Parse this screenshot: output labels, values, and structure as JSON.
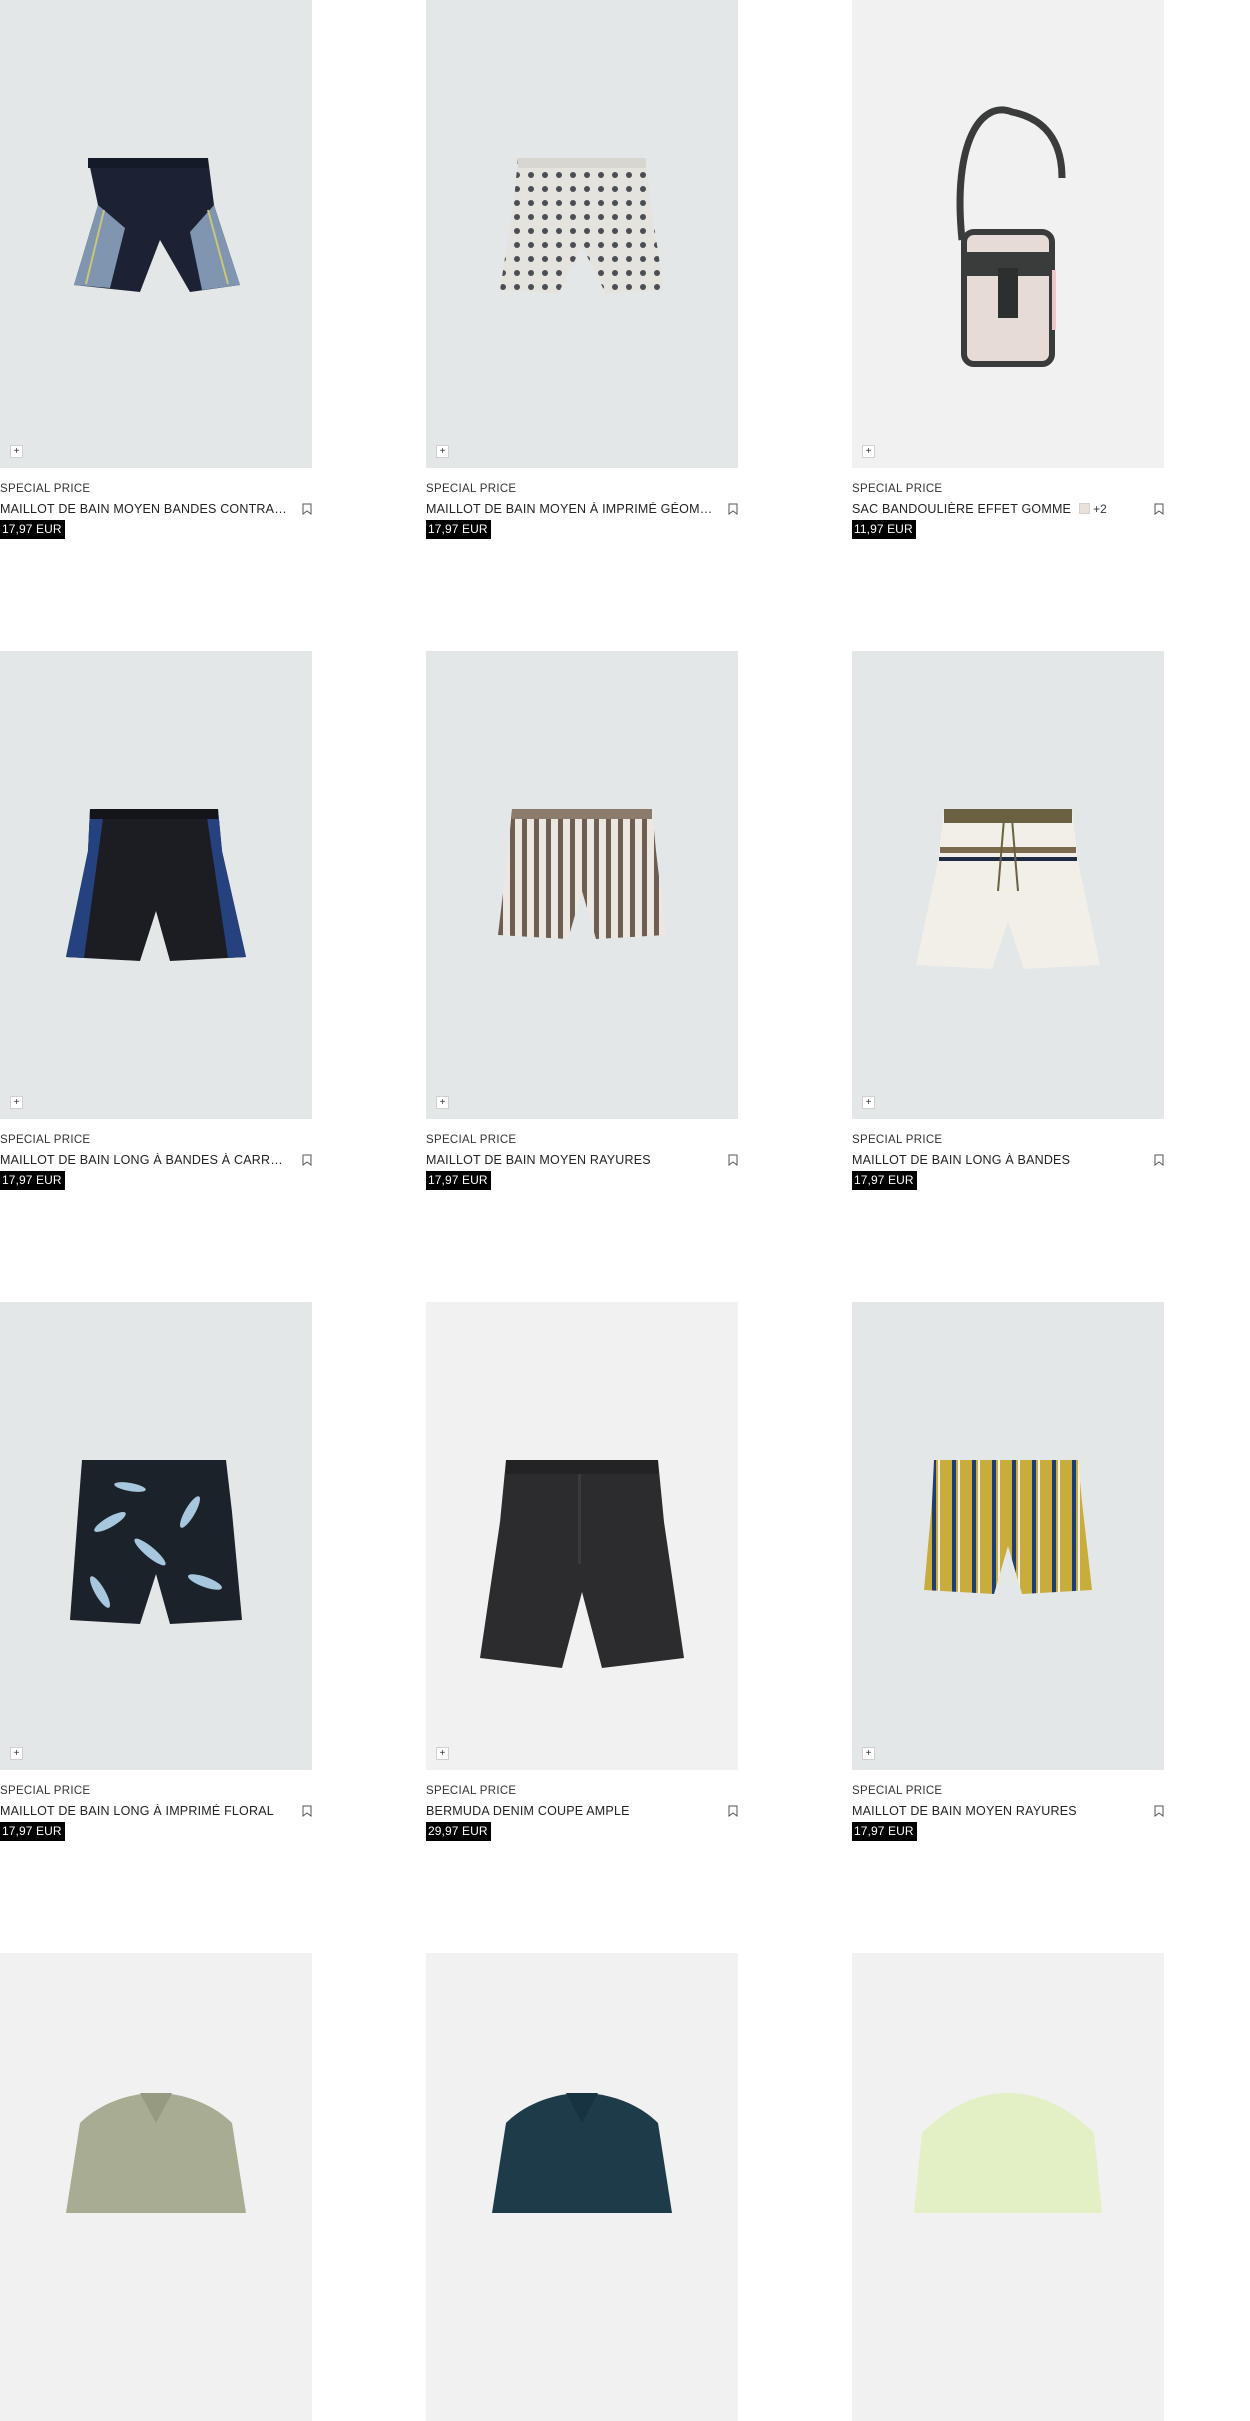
{
  "products": [
    {
      "tag": "SPECIAL PRICE",
      "name": "MAILLOT DE BAIN MOYEN BANDES CONTRAS...",
      "price": "17,97 EUR",
      "bg": "cool",
      "icon": "plus-icon"
    },
    {
      "tag": "SPECIAL PRICE",
      "name": "MAILLOT DE BAIN MOYEN À IMPRIMÉ GÉOMÉT...",
      "price": "17,97 EUR",
      "bg": "cool",
      "icon": "plus-icon"
    },
    {
      "tag": "SPECIAL PRICE",
      "name": "SAC BANDOULIÈRE EFFET GOMME",
      "extra": "+2",
      "price": "11,97 EUR",
      "bg": "warm",
      "icon": "plus-icon"
    },
    {
      "tag": "SPECIAL PRICE",
      "name": "MAILLOT DE BAIN LONG À BANDES À CARREA...",
      "price": "17,97 EUR",
      "bg": "cool",
      "icon": "plus-icon"
    },
    {
      "tag": "SPECIAL PRICE",
      "name": "MAILLOT DE BAIN MOYEN RAYURES",
      "price": "17,97 EUR",
      "bg": "cool",
      "icon": "plus-icon"
    },
    {
      "tag": "SPECIAL PRICE",
      "name": "MAILLOT DE BAIN LONG À BANDES",
      "price": "17,97 EUR",
      "bg": "cool",
      "icon": "plus-icon"
    },
    {
      "tag": "SPECIAL PRICE",
      "name": "MAILLOT DE BAIN LONG À IMPRIMÉ FLORAL",
      "price": "17,97 EUR",
      "bg": "cool",
      "icon": "plus-icon"
    },
    {
      "tag": "SPECIAL PRICE",
      "name": "BERMUDA DENIM COUPE AMPLE",
      "price": "29,97 EUR",
      "bg": "warm",
      "icon": "plus-icon"
    },
    {
      "tag": "SPECIAL PRICE",
      "name": "MAILLOT DE BAIN MOYEN RAYURES",
      "price": "17,97 EUR",
      "bg": "cool",
      "icon": "plus-icon"
    },
    {
      "bg": "warm"
    },
    {
      "bg": "warm"
    },
    {
      "bg": "warm"
    }
  ],
  "colors": {
    "price_bg": "#000000",
    "image_bg_cool": "#e3e7e8",
    "image_bg_warm": "#f1f1f1"
  }
}
